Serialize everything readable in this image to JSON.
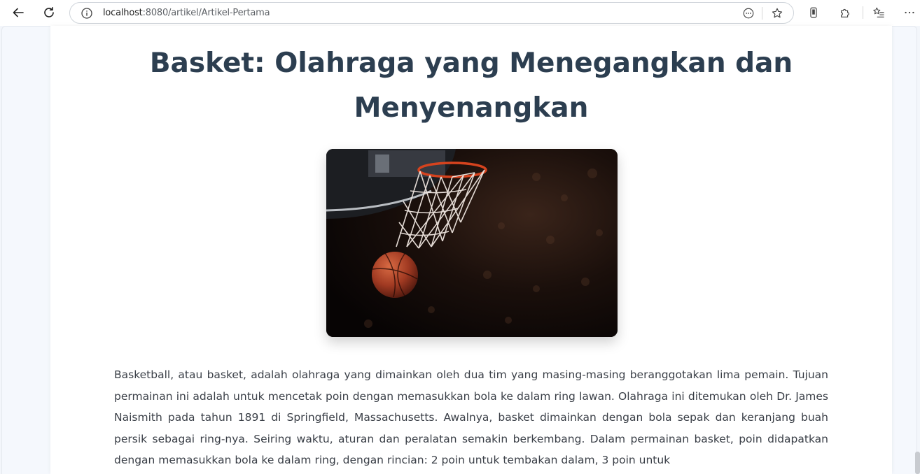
{
  "browser": {
    "url_host": "localhost",
    "url_path": ":8080/artikel/Artikel-Pertama",
    "icons": [
      "back-arrow-icon",
      "reload-icon",
      "info-icon",
      "reading-view-icon",
      "favorite-star-icon",
      "device-icon",
      "extensions-icon",
      "favorites-list-icon",
      "more-icon"
    ]
  },
  "article": {
    "title": "Basket: Olahraga yang Menegangkan dan Menyenangkan",
    "image_alt": "Bola basket jatuh melewati ring",
    "body": "Basketball, atau basket, adalah olahraga yang dimainkan oleh dua tim yang masing-masing beranggotakan lima pemain. Tujuan permainan ini adalah untuk mencetak poin dengan memasukkan bola ke dalam ring lawan. Olahraga ini ditemukan oleh Dr. James Naismith pada tahun 1891 di Springfield, Massachusetts. Awalnya, basket dimainkan dengan bola sepak dan keranjang buah persik sebagai ring-nya. Seiring waktu, aturan dan peralatan semakin berkembang. Dalam permainan basket, poin didapatkan dengan memasukkan bola ke dalam ring, dengan rincian: 2 poin untuk tembakan dalam, 3 poin untuk"
  },
  "colors": {
    "title": "#2c3e50",
    "text": "#3a3f47",
    "page_bg": "#f5f8fd",
    "card_bg": "#ffffff"
  }
}
